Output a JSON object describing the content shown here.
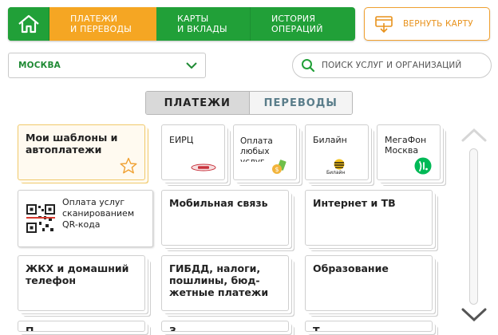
{
  "nav": {
    "home_icon": "home-icon",
    "tabs": [
      {
        "line1": "ПЛАТЕЖИ",
        "line2": "И ПЕРЕВОДЫ"
      },
      {
        "line1": "КАРТЫ",
        "line2": "И ВКЛАДЫ"
      },
      {
        "line1": "ИСТОРИЯ",
        "line2": "ОПЕРАЦИЙ"
      }
    ],
    "return_card": "ВЕРНУТЬ КАРТУ"
  },
  "city": {
    "value": "МОСКВА"
  },
  "search": {
    "placeholder": "ПОИСК УСЛУГ И ОРГАНИЗАЦИЙ"
  },
  "segment": {
    "payments": "ПЛАТЕЖИ",
    "transfers": "ПЕРЕВОДЫ"
  },
  "tiles": {
    "templates": {
      "line1": "Мои шаблоны и",
      "line2": "автоплатежи"
    },
    "eirc": "ЕИРЦ",
    "any": {
      "line1": "Оплата",
      "line2": "любых",
      "line3": "услуг"
    },
    "beeline": {
      "title": "Билайн",
      "logo": "Билайн"
    },
    "megafon": {
      "line1": "МегаФон",
      "line2": "Москва"
    },
    "qr": {
      "line1": "Оплата услуг",
      "line2": "сканированием",
      "line3": "QR-кода"
    },
    "mobile": "Мобильная связь",
    "internet": "Интернет и ТВ",
    "zhkh": {
      "line1": "ЖКХ и домашний",
      "line2": "телефон"
    },
    "gibdd": {
      "line1": "ГИБДД, налоги,",
      "line2": "пошлины, бюд-",
      "line3": "жетные платежи"
    },
    "education": "Образование",
    "row4a": "П",
    "row4b": "З",
    "row4c": "Т"
  },
  "colors": {
    "brand_green": "#21a038",
    "accent_orange": "#f5a623"
  }
}
